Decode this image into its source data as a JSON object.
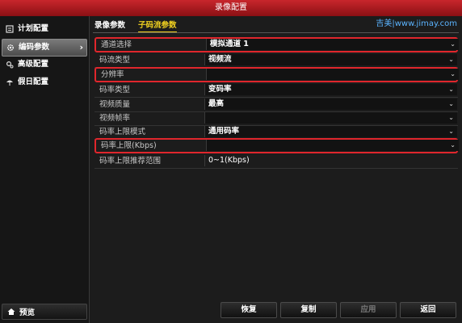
{
  "window": {
    "title": "录像配置"
  },
  "sidebar": {
    "items": [
      {
        "label": "计划配置",
        "icon": "schedule-icon",
        "active": false
      },
      {
        "label": "编码参数",
        "icon": "gear-icon",
        "active": true
      },
      {
        "label": "高级配置",
        "icon": "advanced-settings-icon",
        "active": false
      },
      {
        "label": "假日配置",
        "icon": "umbrella-icon",
        "active": false
      }
    ],
    "preview_label": "预览"
  },
  "tabs": [
    {
      "label": "录像参数",
      "active": false
    },
    {
      "label": "子码流参数",
      "active": true
    }
  ],
  "watermark": "吉美|www.jimay.com",
  "rows": [
    {
      "label": "通道选择",
      "value": "模拟通道 1",
      "dropdown": true,
      "highlight": true
    },
    {
      "label": "码流类型",
      "value": "视频流",
      "dropdown": true,
      "highlight": false
    },
    {
      "label": "分辨率",
      "value": "",
      "dropdown": true,
      "highlight": true
    },
    {
      "label": "码率类型",
      "value": "变码率",
      "dropdown": true,
      "highlight": false
    },
    {
      "label": "视频质量",
      "value": "最高",
      "dropdown": true,
      "highlight": false
    },
    {
      "label": "视频帧率",
      "value": "",
      "dropdown": true,
      "highlight": false
    },
    {
      "label": "码率上限模式",
      "value": "通用码率",
      "dropdown": true,
      "highlight": false
    },
    {
      "label": "码率上限(Kbps)",
      "value": "",
      "dropdown": true,
      "highlight": true
    },
    {
      "label": "码率上限推荐范围",
      "value": "0~1(Kbps)",
      "dropdown": false,
      "highlight": false
    }
  ],
  "buttons": [
    {
      "label": "恢复",
      "enabled": true
    },
    {
      "label": "复制",
      "enabled": true
    },
    {
      "label": "应用",
      "enabled": false
    },
    {
      "label": "返回",
      "enabled": true
    }
  ],
  "colors": {
    "accent": "#e0262c",
    "titlebar": "#b01a20",
    "active_tab": "#f0d020",
    "watermark": "#5bb4ff"
  }
}
